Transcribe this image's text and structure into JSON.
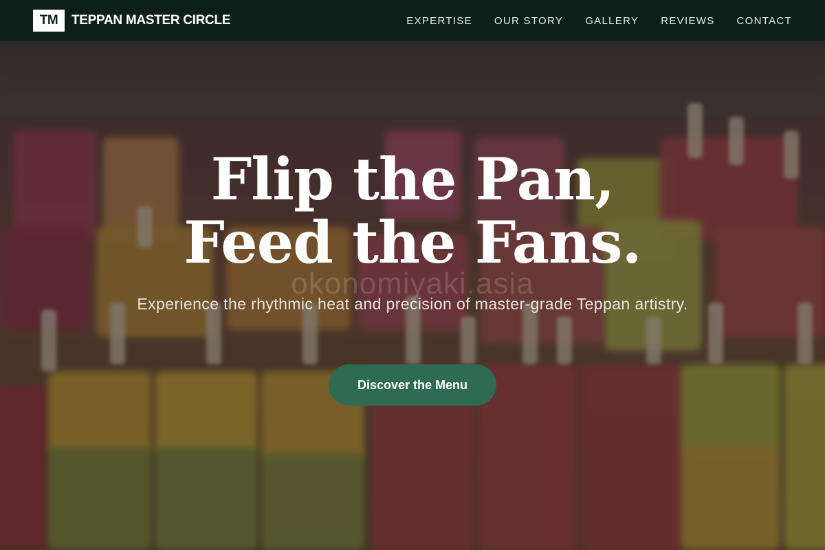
{
  "brand": {
    "mark": "TM",
    "name": "TEPPAN MASTER CIRCLE"
  },
  "nav": {
    "items": [
      {
        "label": "EXPERTISE"
      },
      {
        "label": "OUR STORY"
      },
      {
        "label": "GALLERY"
      },
      {
        "label": "REVIEWS"
      },
      {
        "label": "CONTACT"
      }
    ]
  },
  "hero": {
    "headline_line1": "Flip the Pan,",
    "headline_line2": "Feed the Fans.",
    "watermark": "okonomiyaki.asia",
    "subtitle": "Experience the rhythmic heat and precision of master-grade Teppan artistry.",
    "cta_label": "Discover the Menu"
  },
  "colors": {
    "navbar": "#0e1f1a",
    "cta": "#2f6b52",
    "headline": "#ffffff"
  }
}
